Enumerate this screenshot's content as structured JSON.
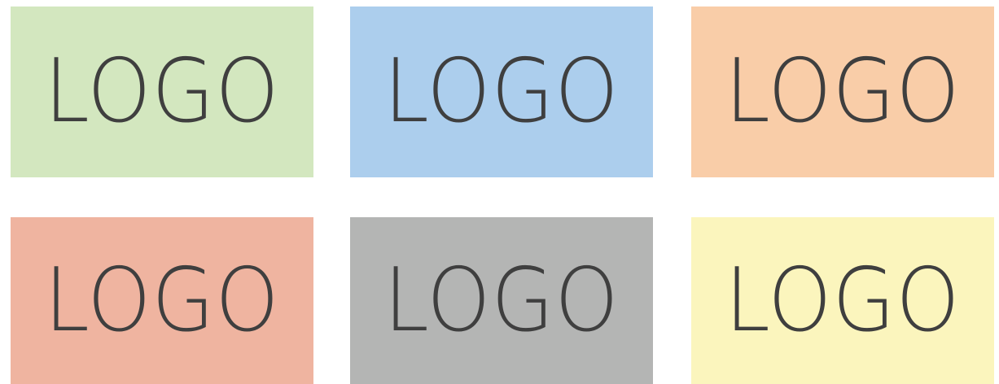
{
  "tiles": [
    {
      "label": "LOGO",
      "color": "#d3e7bf"
    },
    {
      "label": "LOGO",
      "color": "#acceed"
    },
    {
      "label": "LOGO",
      "color": "#f9cda8"
    },
    {
      "label": "LOGO",
      "color": "#efb4a0"
    },
    {
      "label": "LOGO",
      "color": "#b4b5b4"
    },
    {
      "label": "LOGO",
      "color": "#fbf5bd"
    }
  ],
  "text_color": "#3f3f3f"
}
